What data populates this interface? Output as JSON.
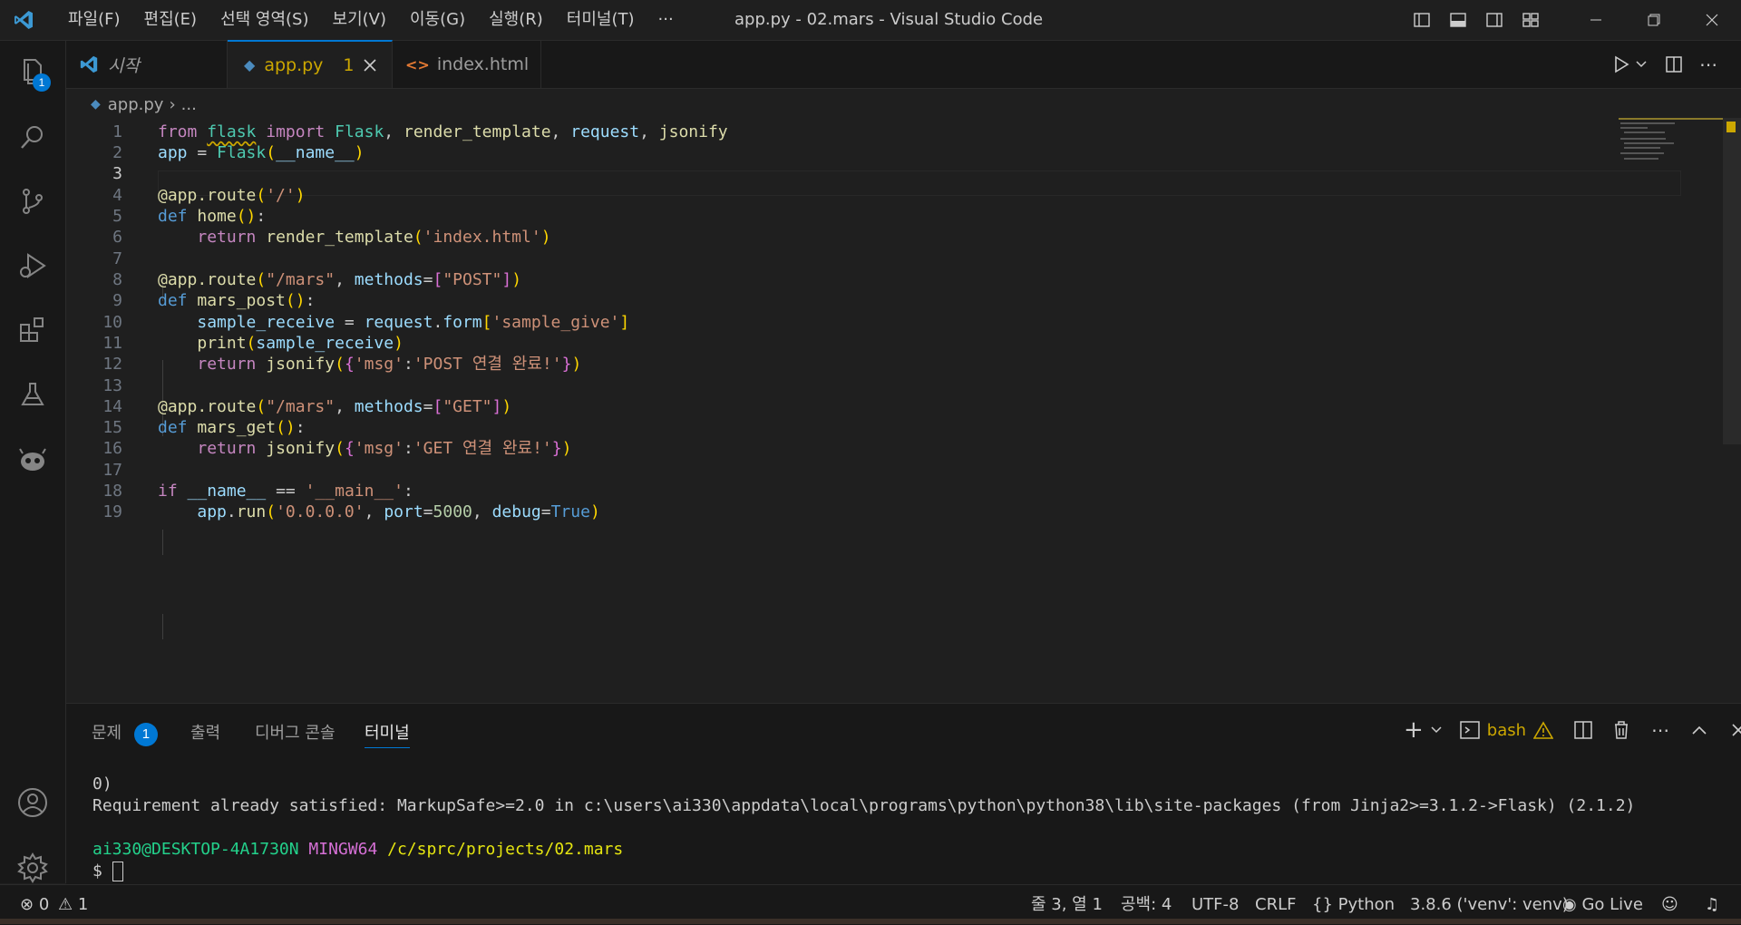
{
  "window": {
    "title": "app.py - 02.mars - Visual Studio Code",
    "menu": [
      "파일(F)",
      "편집(E)",
      "선택 영역(S)",
      "보기(V)",
      "이동(G)",
      "실행(R)",
      "터미널(T)",
      "···"
    ]
  },
  "activity": {
    "explorer_badge": "1"
  },
  "tabs": [
    {
      "label": "시작",
      "icon": "vscode-icon"
    },
    {
      "label": "app.py",
      "icon": "python-icon",
      "problems": "1",
      "active": true
    },
    {
      "label": "index.html",
      "icon": "html-icon",
      "modified": true
    }
  ],
  "breadcrumb": {
    "file": "app.py",
    "rest": "..."
  },
  "editor": {
    "line_numbers": [
      "1",
      "2",
      "3",
      "4",
      "5",
      "6",
      "7",
      "8",
      "9",
      "10",
      "11",
      "12",
      "13",
      "14",
      "15",
      "16",
      "17",
      "18",
      "19"
    ],
    "current_line": "3"
  },
  "panel": {
    "tabs": [
      "문제",
      "출력",
      "디버그 콘솔",
      "터미널"
    ],
    "problems_badge": "1",
    "shell": "bash",
    "terminal_lines": [
      "0)",
      "Requirement already satisfied: MarkupSafe>=2.0 in c:\\users\\ai330\\appdata\\local\\programs\\python\\python38\\lib\\site-packages (from Jinja2>=3.1.2->Flask) (2.1.2)"
    ],
    "prompt_user": "ai330@DESKTOP-4A1730N",
    "prompt_env": "MINGW64",
    "prompt_path": "/c/sprc/projects/02.mars",
    "prompt_symbol": "$"
  },
  "status": {
    "errors": "0",
    "warnings": "1",
    "position": "줄 3, 열 1",
    "spaces": "공백: 4",
    "encoding": "UTF-8",
    "eol": "CRLF",
    "language": "Python",
    "interpreter": "3.8.6 ('venv': venv)",
    "golive": "Go Live"
  },
  "colors": {
    "accent": "#0078d4",
    "keyword": "#c586c0",
    "string": "#ce9178",
    "function": "#dcdcaa"
  }
}
